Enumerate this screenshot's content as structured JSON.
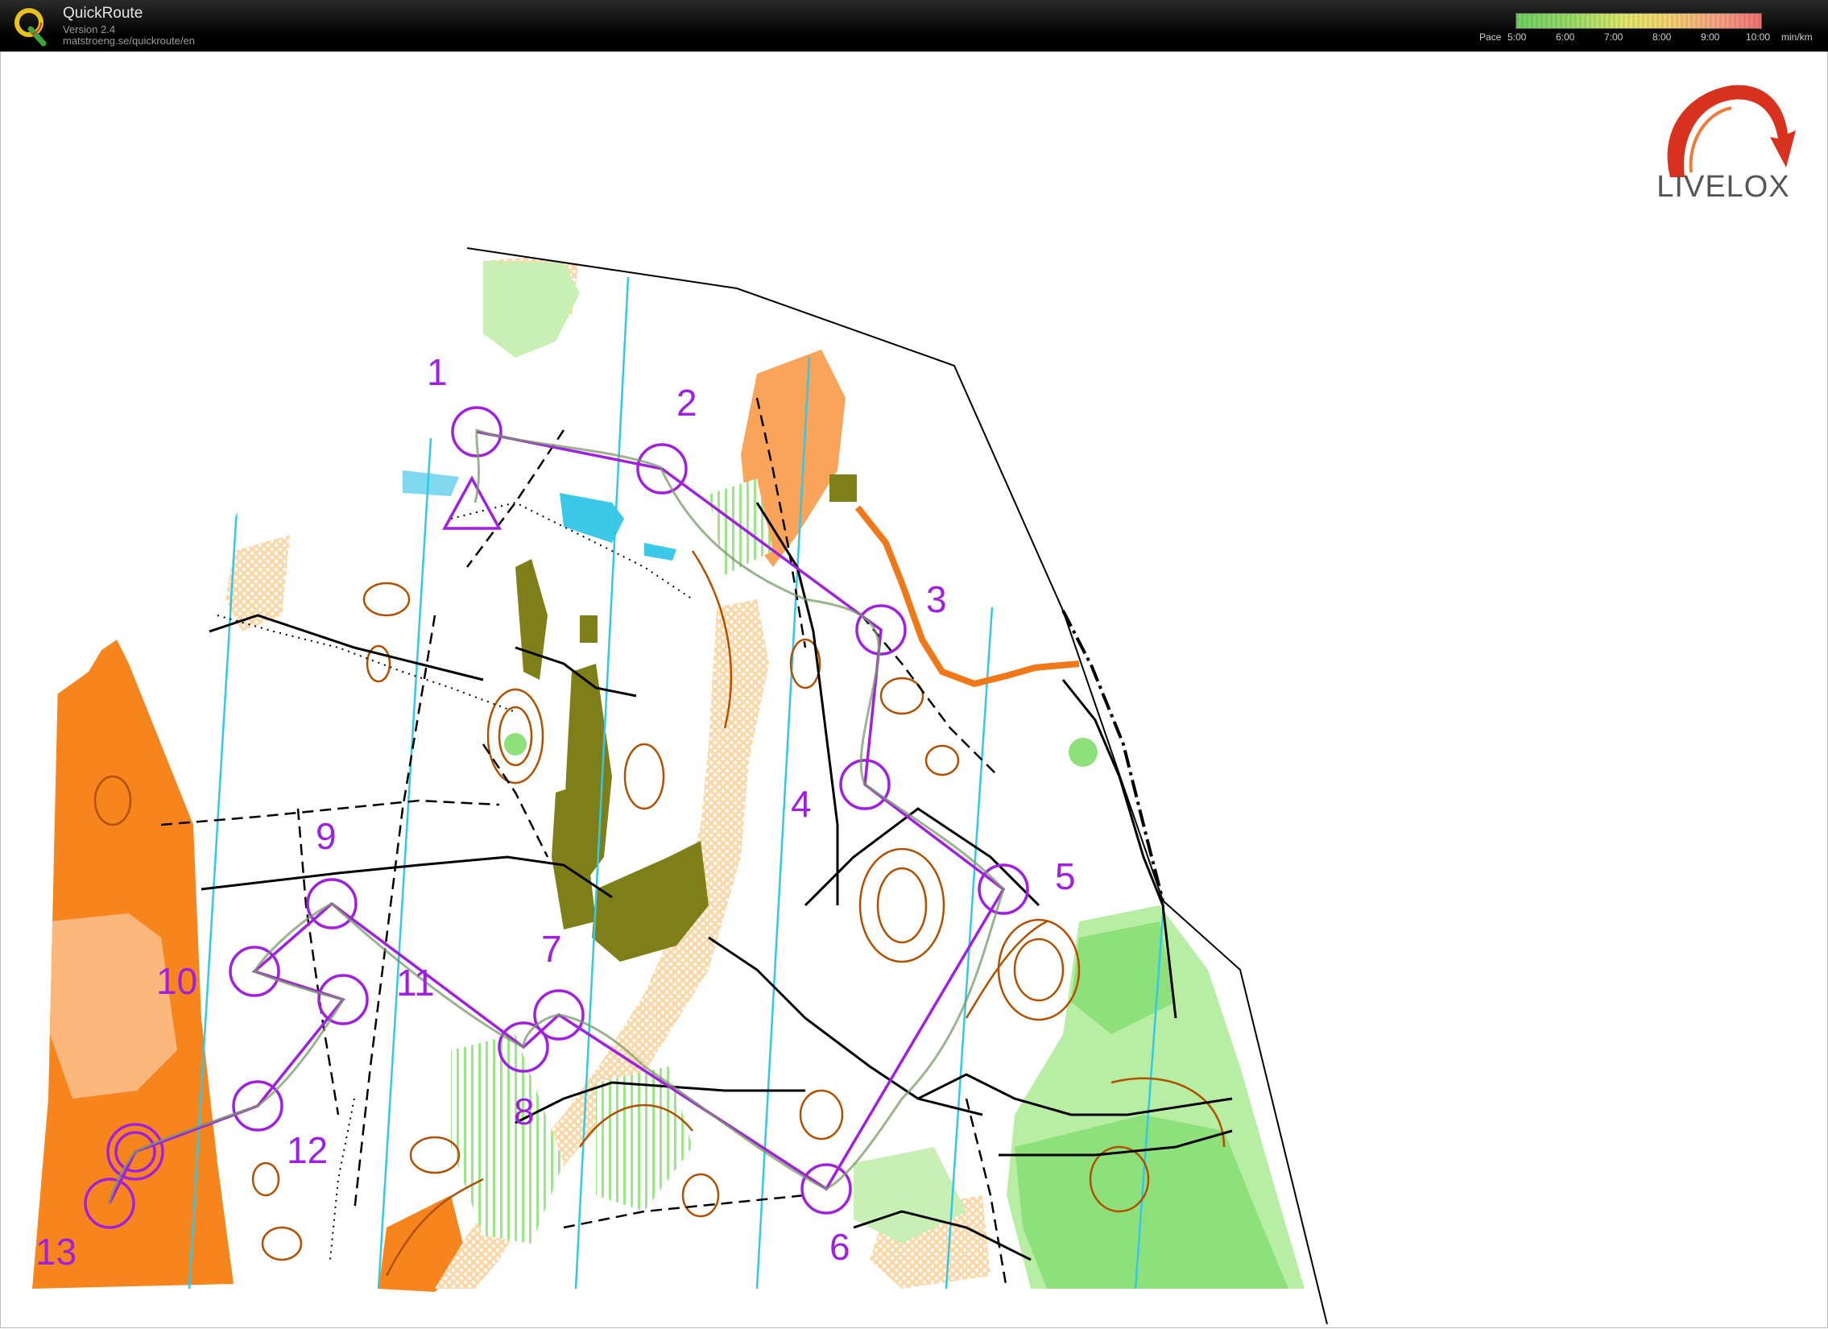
{
  "app": {
    "name": "QuickRoute",
    "version": "Version 2.4",
    "url": "matstroeng.se/quickroute/en"
  },
  "pace_legend": {
    "label": "Pace",
    "ticks": [
      "5:00",
      "6:00",
      "7:00",
      "8:00",
      "9:00",
      "10:00"
    ],
    "unit": "min/km"
  },
  "brand": {
    "name": "LIVELOX"
  },
  "course": {
    "color": "#a020e0",
    "controls": [
      "1",
      "2",
      "3",
      "4",
      "5",
      "6",
      "7",
      "8",
      "9",
      "10",
      "11",
      "12",
      "13"
    ]
  },
  "map_colors": {
    "open_land": "#f9a45a",
    "rough_open": "#fcd0a0",
    "green_light": "#c8f0b4",
    "green_mid": "#8ee07a",
    "olive": "#808019",
    "water": "#3cc8e8",
    "contour": "#b05000",
    "track": "#000000"
  }
}
